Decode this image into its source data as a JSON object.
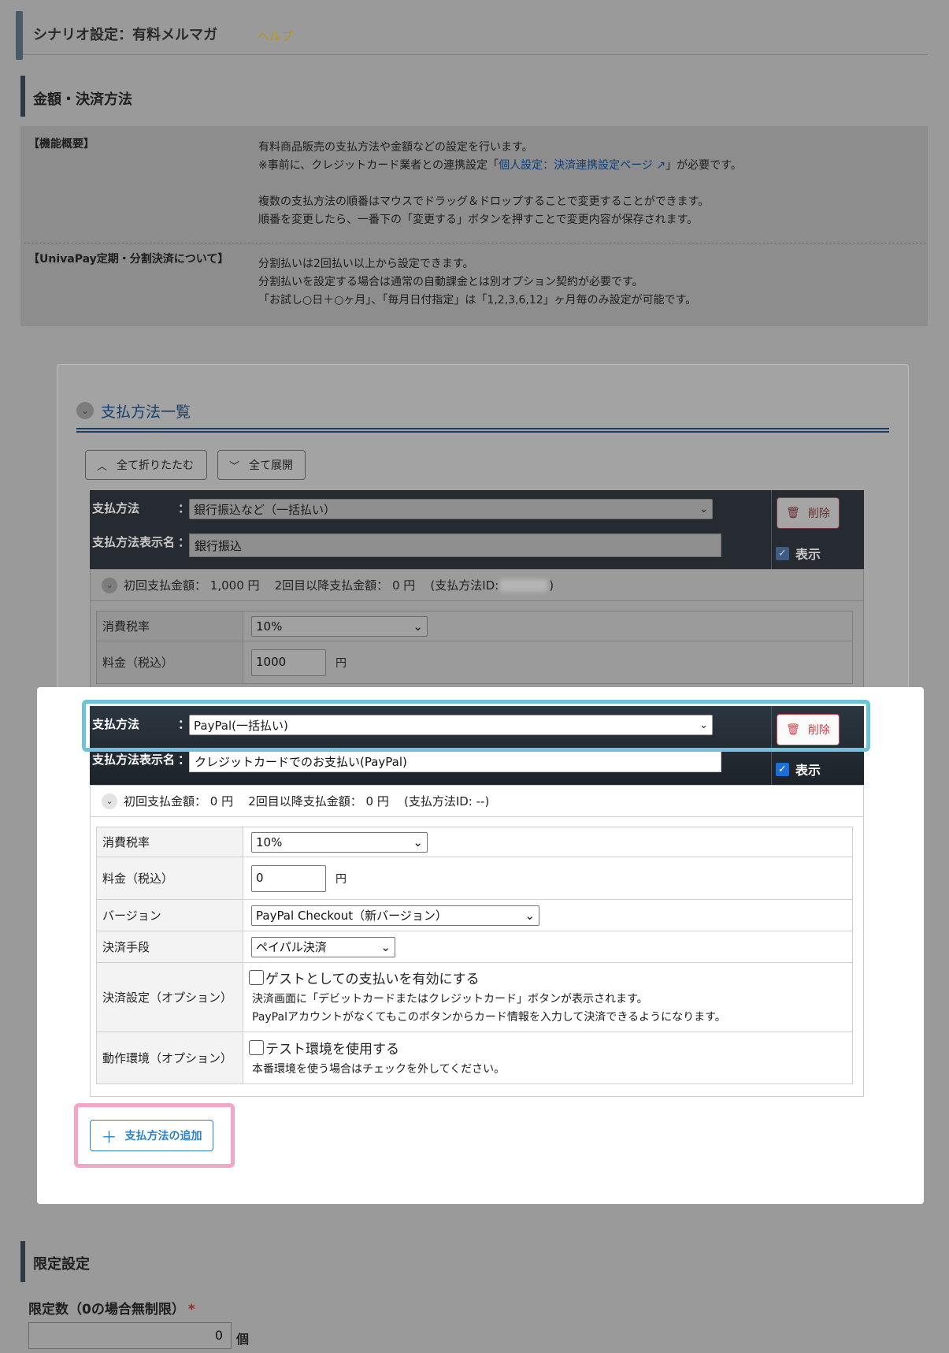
{
  "header": {
    "title": "シナリオ設定：有料メルマガ",
    "help": "ヘルプ"
  },
  "section_payment": {
    "title": "金額・決済方法"
  },
  "info": {
    "overview_label": "【機能概要】",
    "overview_line1": "有料商品販売の支払方法や金額などの設定を行います。",
    "overview_line2_pre": "※事前に、クレジットカード業者との連携設定「",
    "overview_line2_link": "個人設定：決済連携設定ページ",
    "overview_line2_post": "」が必要です。",
    "overview_line3": "複数の支払方法の順番はマウスでドラッグ＆ドロップすることで変更することができます。",
    "overview_line4": "順番を変更したら、一番下の「変更する」ボタンを押すことで変更内容が保存されます。",
    "univa_label": "【UnivaPay定期・分割決済について】",
    "univa_line1": "分割払いは2回払い以上から設定できます。",
    "univa_line2": "分割払いを設定する場合は通常の自動課金とは別オプション契約が必要です。",
    "univa_line3": "「お試し○日＋○ヶ月」、「毎月日付指定」は「1,2,3,6,12」ヶ月毎のみ設定が可能です。"
  },
  "list": {
    "title": "支払方法一覧",
    "collapse_all": "全て折りたたむ",
    "expand_all": "全て展開",
    "add_button": "支払方法の追加"
  },
  "labels": {
    "method": "支払方法",
    "display_name": "支払方法表示名",
    "colon": "：",
    "delete": "削除",
    "show": "表示",
    "first_amount": "初回支払金額：",
    "later_amount": "2回目以降支払金額：",
    "yen": "円",
    "method_id": "(支払方法ID:",
    "tax_rate": "消費税率",
    "price": "料金（税込）",
    "version": "バージョン",
    "payment_means": "決済手段",
    "payment_option": "決済設定（オプション）",
    "env_option": "動作環境（オプション）"
  },
  "methods": [
    {
      "method": "銀行振込など（一括払い）",
      "display_name": "銀行振込",
      "first_amount": "1,000",
      "later_amount": "0",
      "method_id": "",
      "tax_rate": "10%",
      "price": "1000"
    },
    {
      "method": "PayPal(一括払い)",
      "display_name": "クレジットカードでのお支払い(PayPal)",
      "first_amount": "0",
      "later_amount": "0",
      "method_id": "--",
      "tax_rate": "10%",
      "price": "0",
      "version": "PayPal Checkout（新バージョン）",
      "payment_means": "ペイパル決済",
      "guest_label": "ゲストとしての支払いを有効にする",
      "guest_note1": "決済画面に「デビットカードまたはクレジットカード」ボタンが表示されます。",
      "guest_note2": "PayPalアカウントがなくてもこのボタンからカード情報を入力して決済できるようになります。",
      "test_label": "テスト環境を使用する",
      "test_note": "本番環境を使う場合はチェックを外してください。"
    }
  ],
  "section_limit": {
    "title": "限定設定",
    "count_label": "限定数（0の場合無制限）",
    "required_mark": "*",
    "count_value": "0",
    "count_unit": "個"
  },
  "colors": {
    "highlight_blue": "#6ec3d9",
    "highlight_pink": "#f3a6c8",
    "link": "#2b80c4",
    "danger": "#d03b42"
  }
}
